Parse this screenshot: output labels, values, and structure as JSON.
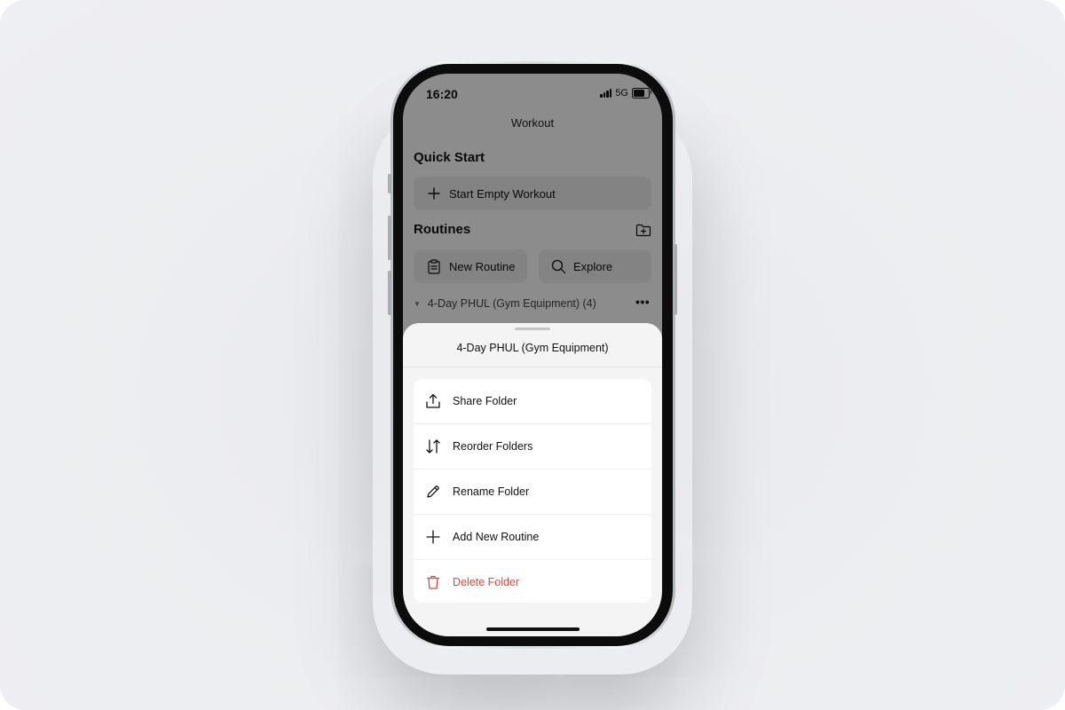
{
  "status_bar": {
    "time": "16:20",
    "network": "5G"
  },
  "header": {
    "title": "Workout"
  },
  "quick_start": {
    "title": "Quick Start",
    "start_empty_label": "Start Empty Workout"
  },
  "routines": {
    "title": "Routines",
    "new_routine_label": "New Routine",
    "explore_label": "Explore",
    "folder_label": "4-Day PHUL (Gym Equipment) (4)"
  },
  "sheet": {
    "title": "4-Day PHUL (Gym Equipment)",
    "items": [
      {
        "label": "Share Folder",
        "icon": "share-icon"
      },
      {
        "label": "Reorder Folders",
        "icon": "reorder-arrows-icon"
      },
      {
        "label": "Rename Folder",
        "icon": "pencil-icon"
      },
      {
        "label": "Add New Routine",
        "icon": "plus-icon"
      },
      {
        "label": "Delete Folder",
        "icon": "trash-icon"
      }
    ]
  },
  "colors": {
    "danger": "#e0463a",
    "overlay": "rgba(0,0,0,0.45)",
    "sheet_background": "#f4f4f5",
    "pill_background": "#eeeeef"
  }
}
